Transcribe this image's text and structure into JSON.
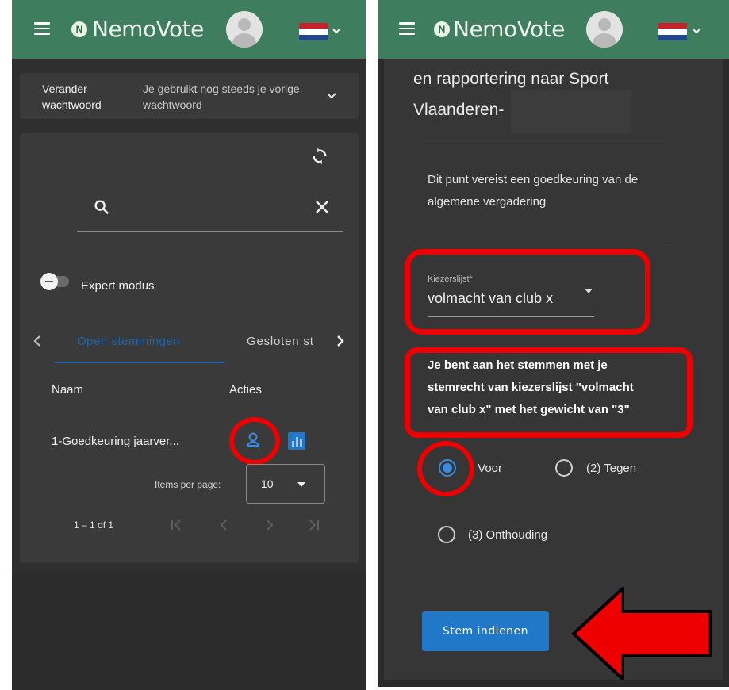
{
  "app": {
    "name": "NemoVote",
    "logo_letter": "N"
  },
  "colors": {
    "appbar": "#3e7d5e",
    "accent": "#2178c9",
    "highlight": "#ee0000",
    "background": "#2f2f2f"
  },
  "left": {
    "password": {
      "label": "Verander wachtwoord",
      "message": "Je gebruikt nog steeds je vorige wachtwoord"
    },
    "search": {
      "value": ""
    },
    "expert_mode": {
      "label": "Expert modus",
      "enabled": false
    },
    "tabs": [
      "Open stemmingen",
      "Gesloten st"
    ],
    "table": {
      "headers": [
        "Naam",
        "Acties"
      ],
      "rows": [
        {
          "name": "1-Goedkeuring jaarver..."
        }
      ]
    },
    "pagination": {
      "items_per_page_label": "Items per page:",
      "items_per_page": "10",
      "range": "1 – 1 of 1"
    }
  },
  "right": {
    "title_line1": "en rapportering naar Sport",
    "title_line2": "Vlaanderen-",
    "approval_note_line1": "Dit punt vereist een goedkeuring van de",
    "approval_note_line2": "algemene vergadering",
    "voter_list": {
      "label": "Kiezerslijst*",
      "value": "volmacht van club x"
    },
    "voting_info_line1": "Je bent aan het stemmen met je",
    "voting_info_line2": "stemrecht van kiezerslijst \"volmacht",
    "voting_info_line3": "van club x\" met het gewicht van \"3\"",
    "options": [
      {
        "label": ") Voor",
        "selected": true
      },
      {
        "label": "(2) Tegen",
        "selected": false
      },
      {
        "label": "(3) Onthouding",
        "selected": false
      }
    ],
    "submit_label": "Stem indienen"
  }
}
